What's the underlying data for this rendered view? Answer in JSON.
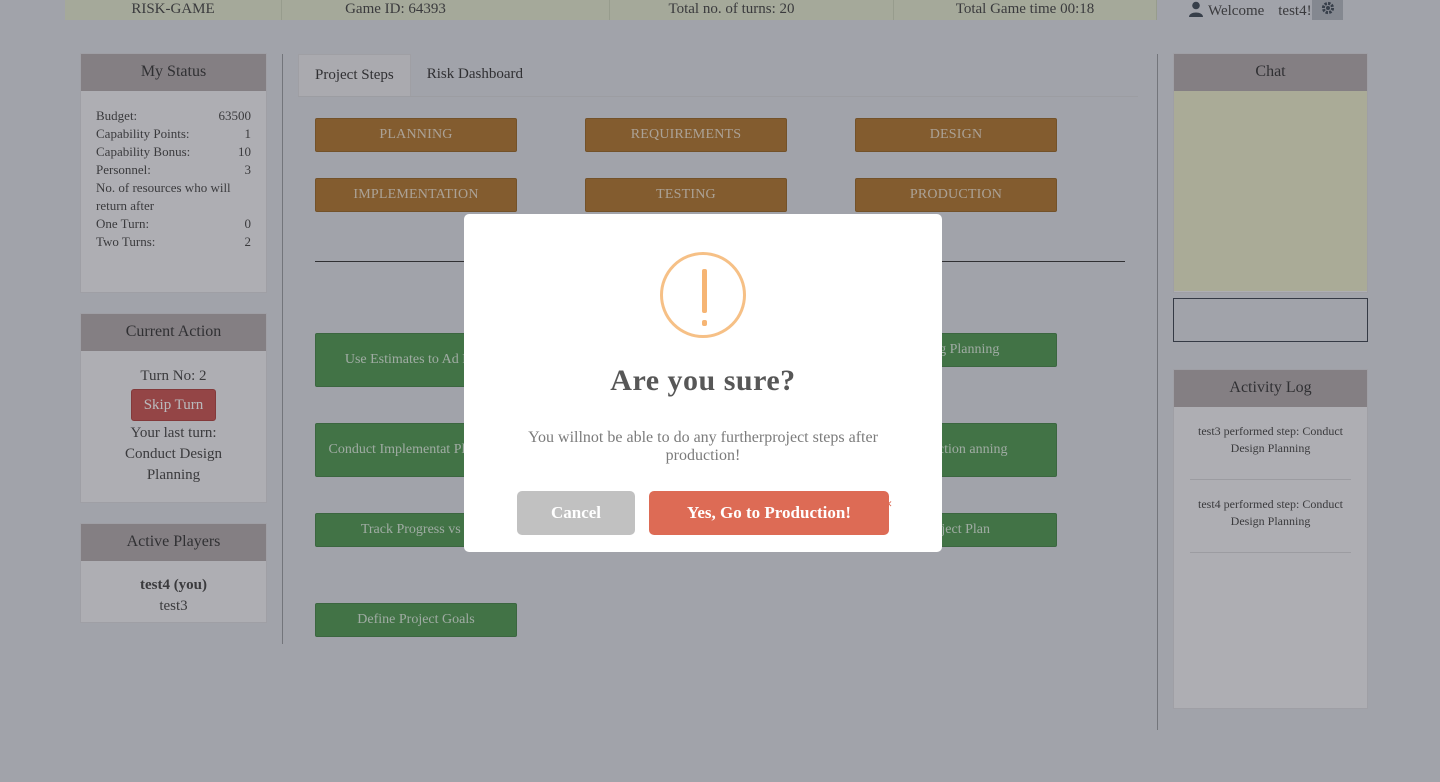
{
  "topbar": {
    "game": "RISK-GAME",
    "game_id": "Game ID: 64393",
    "total_turns": "Total  no. of turns:  20",
    "total_time": "Total  Game  time  00:18",
    "welcome": "Welcome",
    "user": "test4!"
  },
  "status": {
    "title": "My Status",
    "rows": [
      {
        "label": "Budget:",
        "value": "63500"
      },
      {
        "label": "Capability  Points:",
        "value": "1"
      },
      {
        "label": "Capability  Bonus:",
        "value": "10"
      },
      {
        "label": "Personnel:",
        "value": "3"
      }
    ],
    "resources_note": "No. of resources  who  will return  after",
    "rows2": [
      {
        "label": "One Turn:",
        "value": "0"
      },
      {
        "label": "Two Turns:",
        "value": "2"
      }
    ]
  },
  "current_action": {
    "title": "Current  Action",
    "turn_no": "Turn No: 2",
    "skip_label": "Skip Turn",
    "last_turn_label": "Your last turn:",
    "last_turn_value": "Conduct  Design Planning"
  },
  "players": {
    "title": "Active Players",
    "me": "test4 (you)",
    "other": "test3"
  },
  "tabs": [
    "Project Steps",
    "Risk Dashboard"
  ],
  "phases": [
    "PLANNING",
    "REQUIREMENTS",
    "DESIGN",
    "IMPLEMENTATION",
    "TESTING",
    "PRODUCTION"
  ],
  "steps": {
    "s1": "Use Estimates  to Ad Plan",
    "s2": "esting  Planning",
    "s3": "Conduct  Implementat Planning",
    "s4": "Production anning",
    "s5": "Track Progress   vs p",
    "s6": "Project Plan",
    "s7": "Define  Project Goals"
  },
  "chat": {
    "title": "Chat"
  },
  "activity": {
    "title": "Activity  Log",
    "entries": [
      "test3  performed   step:  Conduct Design  Planning",
      "test4  performed   step:  Conduct Design  Planning"
    ]
  },
  "modal": {
    "title": "Are you  sure?",
    "text": "You willnot be  able  to do  any  furtherproject steps  after production!",
    "cancel": "Cancel",
    "confirm": "Yes,  Go  to  Production!",
    "close": "×"
  },
  "colors": {
    "phase": "#a86a1c",
    "step": "#3f8f42",
    "skip": "#c44542",
    "confirm": "#dd6b55",
    "warning": "#f6c086"
  }
}
